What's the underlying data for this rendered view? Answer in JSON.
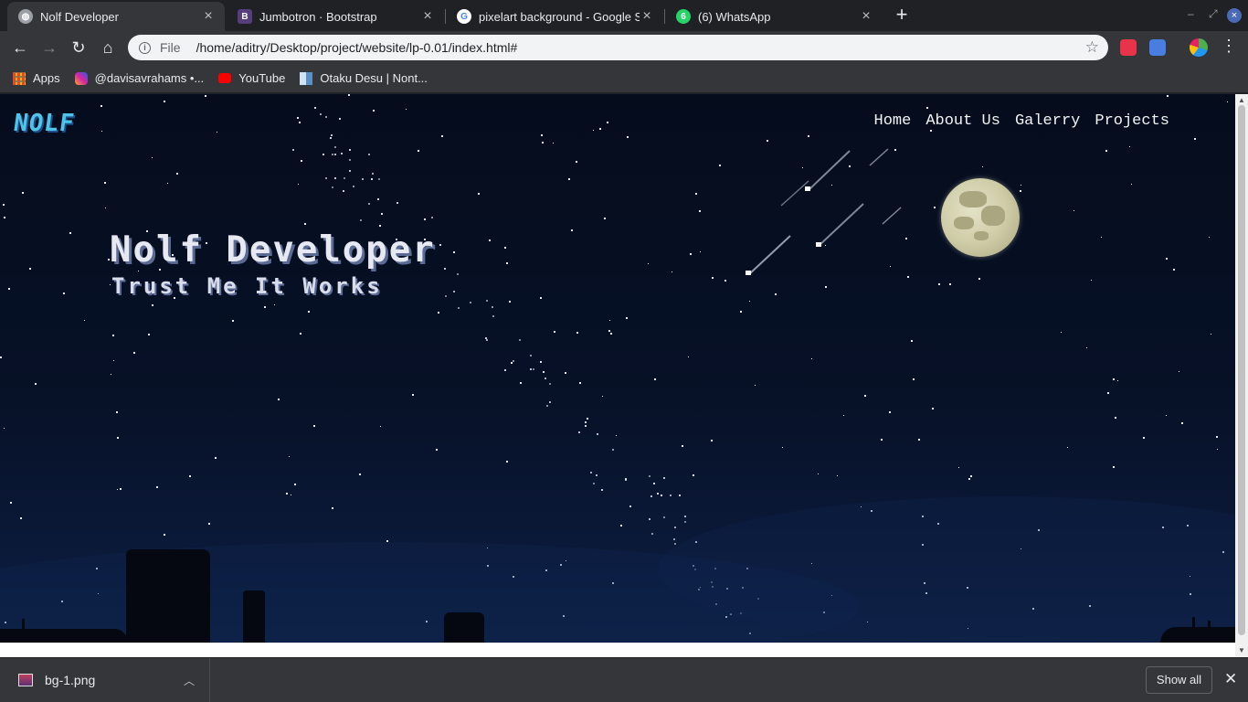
{
  "browser": {
    "tabs": [
      {
        "title": "Nolf Developer",
        "active": true,
        "favicon": "globe-icon",
        "favicon_color": "#9aa0a6"
      },
      {
        "title": "Jumbotron · Bootstrap",
        "active": false,
        "favicon": "bootstrap-icon",
        "favicon_color": "#563d7c"
      },
      {
        "title": "pixelart background - Google Se",
        "active": false,
        "favicon": "google-icon",
        "favicon_color": "#ffffff"
      },
      {
        "title": "(6) WhatsApp",
        "active": false,
        "favicon": "whatsapp-icon",
        "favicon_color": "#25d366"
      }
    ],
    "address": {
      "scheme": "File",
      "url": "/home/aditry/Desktop/project/website/lp-0.01/index.html#"
    },
    "bookmarks": [
      {
        "label": "Apps",
        "icon": "apps-grid-icon"
      },
      {
        "label": "@davisavrahams •...",
        "icon": "instagram-icon"
      },
      {
        "label": "YouTube",
        "icon": "youtube-icon"
      },
      {
        "label": "Otaku Desu | Nont...",
        "icon": "otakudesu-icon"
      }
    ],
    "downloads": {
      "file": "bg-1.png",
      "show_all": "Show all"
    }
  },
  "page": {
    "logo": "NOLF",
    "nav": [
      "Home",
      "About Us",
      "Galerry",
      "Projects"
    ],
    "hero": {
      "title": "Nolf Developer",
      "subtitle": "Trust Me It Works"
    }
  },
  "colors": {
    "sky": "#071127",
    "moon": "#d8d6b4",
    "logo": "#4fc3e8",
    "tab_bar": "#202124",
    "toolbar": "#35363a"
  }
}
